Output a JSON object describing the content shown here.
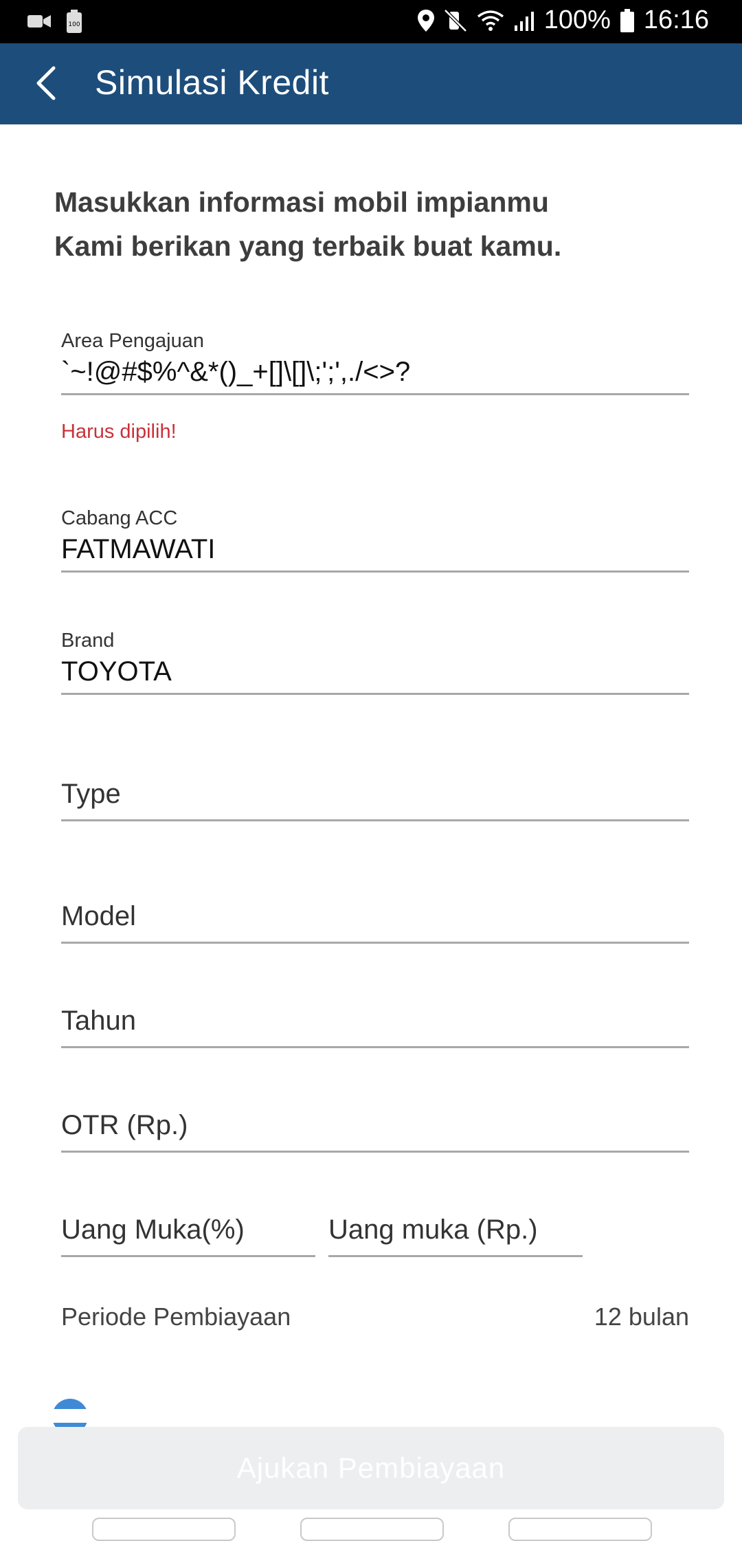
{
  "status_bar": {
    "battery_label": "100%",
    "time": "16:16",
    "left_icons": [
      "video-icon",
      "battery-saver-icon"
    ],
    "right_icons": [
      "location-icon",
      "mute-icon",
      "wifi-icon",
      "signal-icon",
      "battery-icon"
    ]
  },
  "app_bar": {
    "title": "Simulasi Kredit",
    "background": "#1d4d7b"
  },
  "intro": {
    "line1": "Masukkan informasi mobil impianmu",
    "line2": "Kami berikan yang terbaik buat kamu."
  },
  "form": {
    "area": {
      "label": "Area Pengajuan",
      "value": "`~!@#$%^&*()_+[]\\[]\\;';',./<>?",
      "error": "Harus dipilih!"
    },
    "cabang": {
      "label": "Cabang ACC",
      "value": "FATMAWATI"
    },
    "brand": {
      "label": "Brand",
      "value": "TOYOTA"
    },
    "type": {
      "placeholder": "Type"
    },
    "model": {
      "placeholder": "Model"
    },
    "tahun": {
      "placeholder": "Tahun"
    },
    "otr": {
      "placeholder": "OTR (Rp.)"
    },
    "dp_percent": {
      "placeholder": "Uang Muka(%)"
    },
    "dp_amount": {
      "placeholder": "Uang muka (Rp.)"
    },
    "periode": {
      "label": "Periode Pembiayaan",
      "value": "12 bulan"
    }
  },
  "submit_button": {
    "label": "Ajukan Pembiayaan"
  },
  "colors": {
    "error": "#c8323a",
    "accent": "#3f8ad6",
    "disabled_button": "#eceef0"
  }
}
